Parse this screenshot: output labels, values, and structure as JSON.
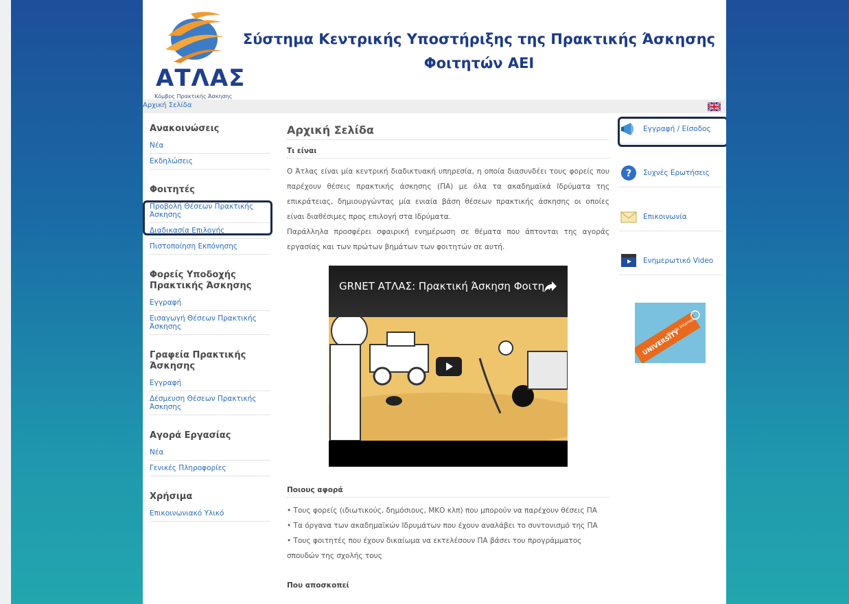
{
  "header": {
    "logo_text": "ΑΤΛΑΣ",
    "logo_subtitle": "Κόμβος Πρακτικής Άσκησης",
    "title_line1": "Σύστημα Κεντρικής Υποστήριξης της Πρακτικής Άσκησης",
    "title_line2": "Φοιτητών ΑΕΙ"
  },
  "breadcrumb": {
    "home": "Αρχική Σελίδα",
    "language_icon": "uk-flag-icon"
  },
  "sidebar": {
    "sections": [
      {
        "heading": "Ανακοινώσεις",
        "items": [
          "Νέα",
          "Εκδηλώσεις"
        ]
      },
      {
        "heading": "Φοιτητές",
        "items": [
          "Προβολή Θέσεων Πρακτικής Άσκησης",
          "Διαδικασία Επιλογής",
          "Πιστοποίηση Εκπόνησης"
        ]
      },
      {
        "heading": "Φορείς Υποδοχής Πρακτικής Άσκησης",
        "items": [
          "Εγγραφή",
          "Εισαγωγή Θέσεων Πρακτικής Άσκησης"
        ]
      },
      {
        "heading": "Γραφεία Πρακτικής Άσκησης",
        "items": [
          "Εγγραφή",
          "Δέσμευση Θέσεων Πρακτικής Άσκησης"
        ]
      },
      {
        "heading": "Αγορά Εργασίας",
        "items": [
          "Νέα",
          "Γενικές Πληροφορίες"
        ]
      },
      {
        "heading": "Χρήσιμα",
        "items": [
          "Επικοινωνιακό Υλικό"
        ]
      }
    ]
  },
  "main": {
    "title": "Αρχική Σελίδα",
    "what_heading": "Τι είναι",
    "para1": "Ο Άτλας είναι μία κεντρική διαδικτυακή υπηρεσία, η οποία διασυνδέει τους φορείς που παρέχουν θέσεις πρακτικής άσκησης (ΠΑ) με όλα τα ακαδημαϊκά Ιδρύματα της επικράτειας, δημιουργώντας μία ενιαία βάση θέσεων πρακτικής άσκησης οι οποίες είναι διαθέσιμες προς επιλογή στα Ιδρύματα.",
    "para2": "Παράλληλα προσφέρει σφαιρική ενημέρωση σε θέματα που άπτονται της αγοράς εργασίας και των πρώτων βημάτων των φοιτητών σε αυτή.",
    "video_title": "GRNET ΑΤΛΑΣ: Πρακτική Άσκηση Φοιτη...",
    "who_heading": "Ποιους αφορά",
    "who_items": [
      "• Τους φορείς (ιδιωτικούς, δημόσιους, ΜΚΟ κλπ) που μπορούν να παρέχουν θέσεις ΠΑ",
      "• Τα όργανα των ακαδημαϊκών Ιδρυμάτων που έχουν αναλάβει το συντονισμό της ΠΑ",
      "• Τους φοιτητές που έχουν δικαίωμα να εκτελέσουν ΠΑ βάσει του προγράμματος σπουδών της σχολής τους"
    ],
    "aim_heading": "Που αποσκοπεί"
  },
  "right": {
    "items": [
      {
        "label": "Εγγραφή / Είσοδος",
        "icon": "megaphone-icon"
      },
      {
        "label": "Συχνές Ερωτήσεις",
        "icon": "help-icon"
      },
      {
        "label": "Επικοινωνία",
        "icon": "envelope-icon"
      },
      {
        "label": "Ενημερωτικό Video",
        "icon": "video-icon"
      }
    ],
    "promo_line1": "UNIVERSITY",
    "promo_line2": "Mobile Internet"
  },
  "colors": {
    "accent_blue": "#1c3b87",
    "link_blue": "#2a6cc0",
    "logo_orange": "#f29a2e"
  }
}
